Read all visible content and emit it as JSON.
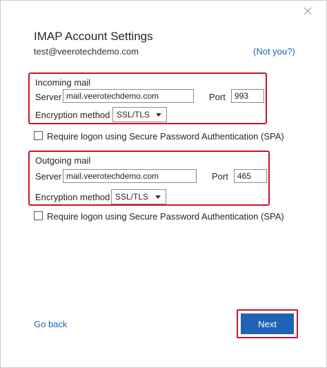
{
  "dialog": {
    "title": "IMAP Account Settings",
    "email": "test@veerotechdemo.com",
    "not_you_link": "(Not you?)"
  },
  "incoming": {
    "label": "Incoming mail",
    "server_label": "Server",
    "server_value": "mail.veerotechdemo.com",
    "port_label": "Port",
    "port_value": "993",
    "encryption_label": "Encryption method",
    "encryption_value": "SSL/TLS",
    "spa_label": "Require logon using Secure Password Authentication (SPA)"
  },
  "outgoing": {
    "label": "Outgoing mail",
    "server_label": "Server",
    "server_value": "mail.veerotechdemo.com",
    "port_label": "Port",
    "port_value": "465",
    "encryption_label": "Encryption method",
    "encryption_value": "SSL/TLS",
    "spa_label": "Require logon using Secure Password Authentication (SPA)"
  },
  "footer": {
    "go_back": "Go back",
    "next": "Next"
  },
  "colors": {
    "accent": "#1e63b5",
    "link": "#1d63b8",
    "highlight": "#c8102e"
  },
  "icons": {
    "close": "close-icon"
  }
}
